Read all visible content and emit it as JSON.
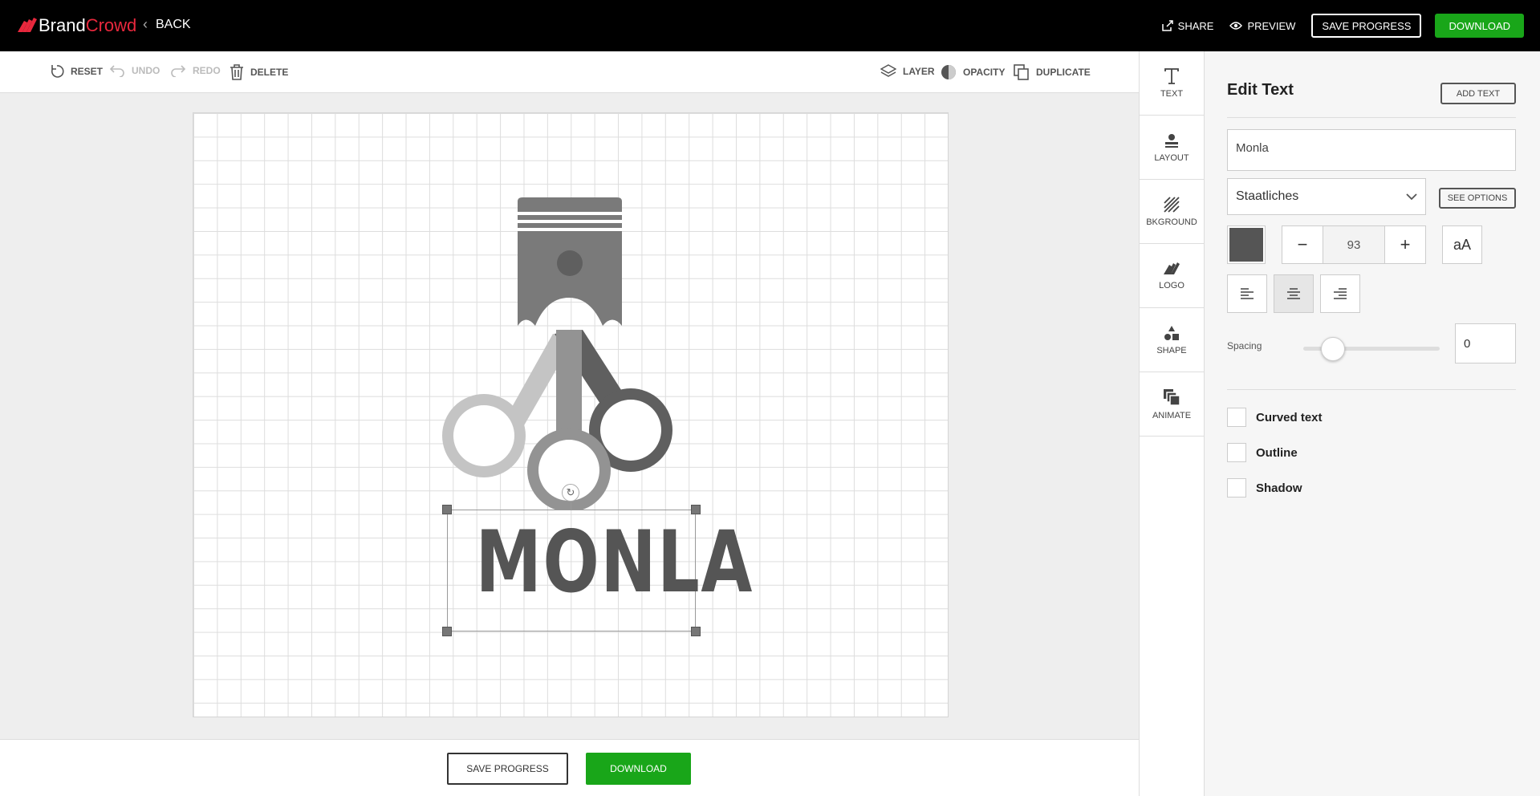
{
  "app": {
    "brand_part1": "Brand",
    "brand_part2": "Crowd",
    "back_label": "BACK"
  },
  "header": {
    "share_label": "SHARE",
    "preview_label": "PREVIEW",
    "save_progress_label": "SAVE PROGRESS",
    "download_label": "DOWNLOAD"
  },
  "toolbar": {
    "reset": "RESET",
    "undo": "UNDO",
    "redo": "REDO",
    "delete": "DELETE",
    "layer": "LAYER",
    "opacity": "OPACITY",
    "duplicate": "DUPLICATE"
  },
  "canvas": {
    "logo_text": "MONLA"
  },
  "bottom": {
    "save_progress_label": "SAVE PROGRESS",
    "download_label": "DOWNLOAD"
  },
  "side_tabs": [
    {
      "label": "TEXT",
      "icon": "text-icon"
    },
    {
      "label": "LAYOUT",
      "icon": "layout-icon"
    },
    {
      "label": "BKGROUND",
      "icon": "background-icon"
    },
    {
      "label": "LOGO",
      "icon": "logo-icon"
    },
    {
      "label": "SHAPE",
      "icon": "shape-icon"
    },
    {
      "label": "ANIMATE",
      "icon": "animate-icon"
    }
  ],
  "panel": {
    "title": "Edit Text",
    "add_text_label": "ADD TEXT",
    "text_value": "Monla",
    "font_name": "Staatliches",
    "see_options_label": "SEE OPTIONS",
    "text_color": "#555555",
    "font_size": "93",
    "case_label": "aA",
    "spacing_label": "Spacing",
    "spacing_value": "0",
    "spacing_level": 0.2,
    "checkboxes": {
      "curved": "Curved text",
      "outline": "Outline",
      "shadow": "Shadow"
    }
  },
  "colors": {
    "accent_green": "#19a619",
    "brand_red": "#e8283d"
  }
}
